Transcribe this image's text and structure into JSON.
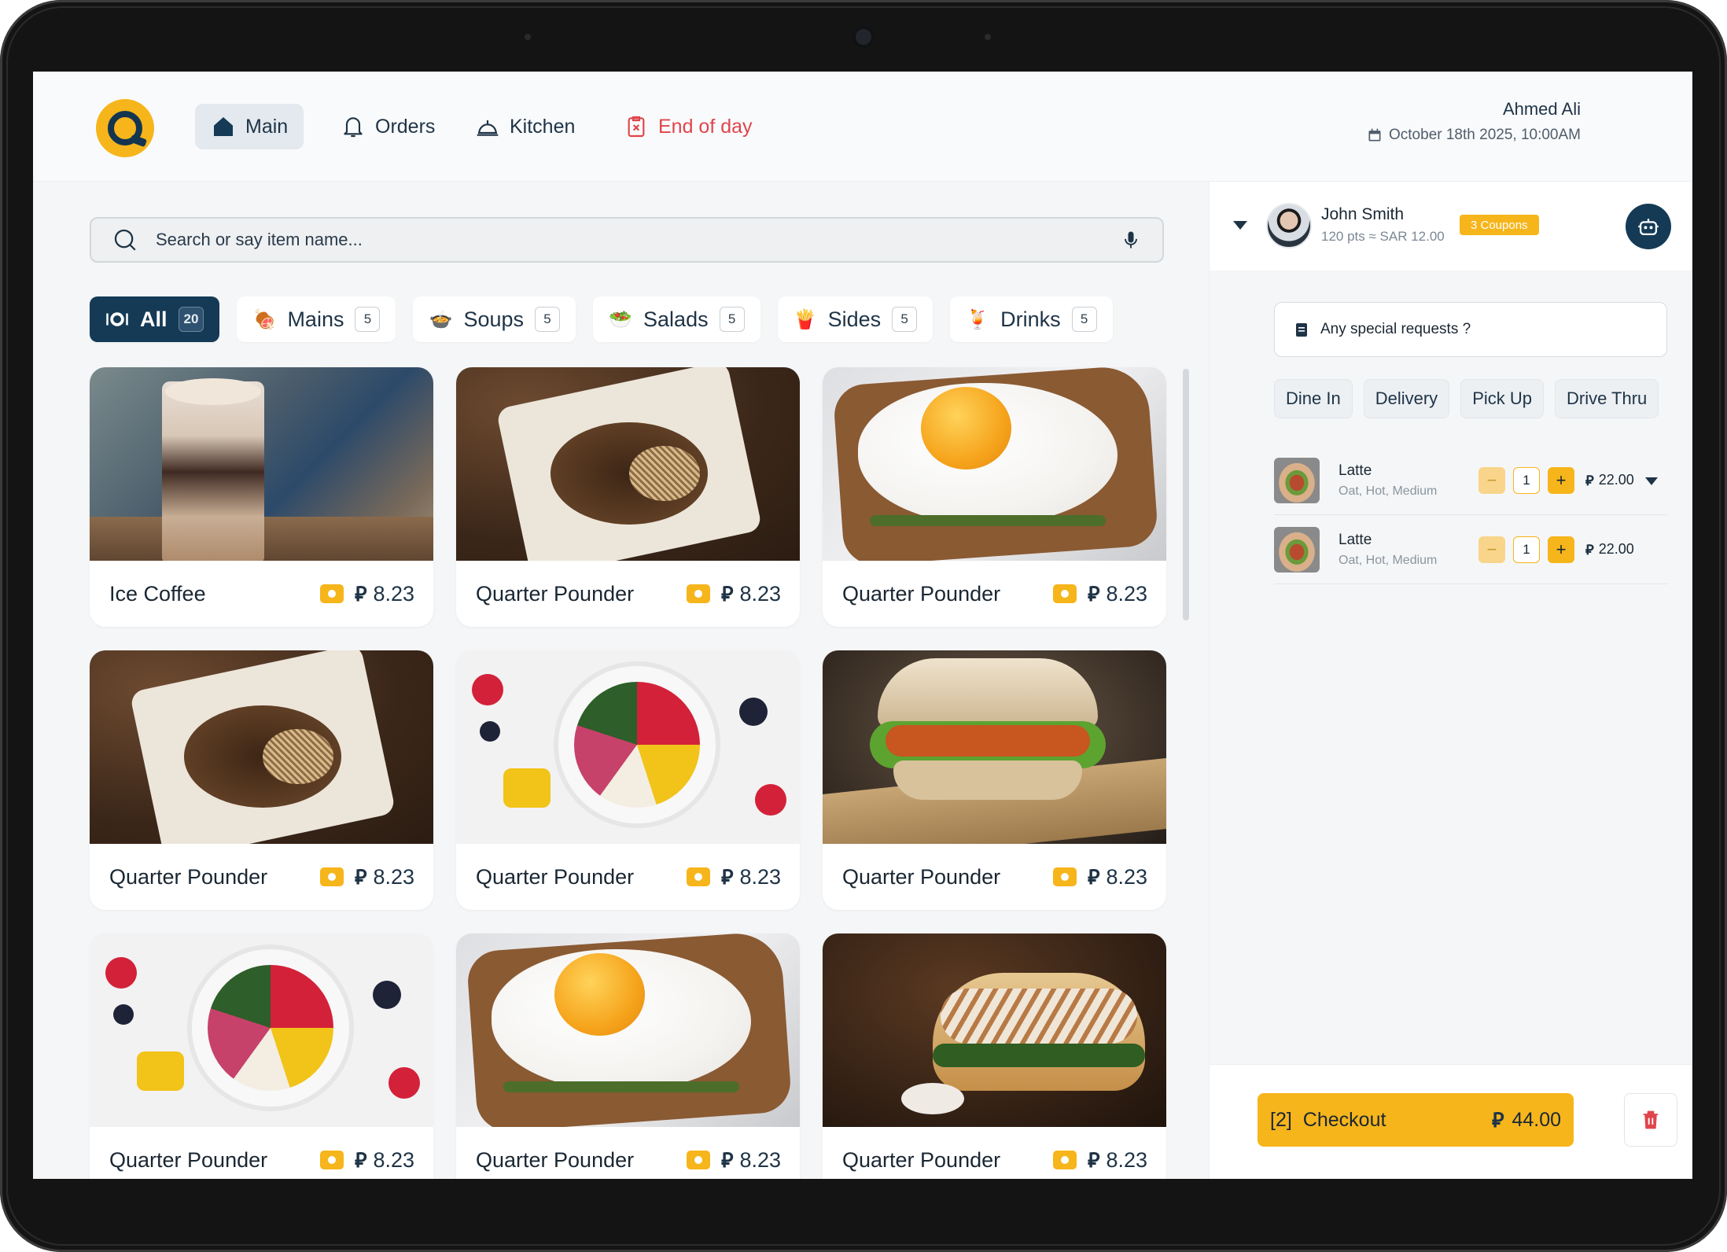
{
  "nav": {
    "items": [
      {
        "label": "Main",
        "icon": "home-icon",
        "active": true
      },
      {
        "label": "Orders",
        "icon": "bell-icon"
      },
      {
        "label": "Kitchen",
        "icon": "cloche-icon"
      },
      {
        "label": "End of day",
        "icon": "clipboard-x-icon",
        "color": "#e0444c"
      }
    ]
  },
  "user": {
    "name": "Ahmed Ali",
    "datetime": "October 18th 2025, 10:00AM"
  },
  "search": {
    "placeholder": "Search or say item name..."
  },
  "categories": [
    {
      "label": "All",
      "count": "20",
      "icon": "plate-icon",
      "active": true
    },
    {
      "label": "Mains",
      "count": "5",
      "icon": "🍖"
    },
    {
      "label": "Soups",
      "count": "5",
      "icon": "🍲"
    },
    {
      "label": "Salads",
      "count": "5",
      "icon": "🥗"
    },
    {
      "label": "Sides",
      "count": "5",
      "icon": "🍟"
    },
    {
      "label": "Drinks",
      "count": "5",
      "icon": "🍹"
    }
  ],
  "currency_symbol": "⃁",
  "products": [
    {
      "name": "Ice Coffee",
      "price": "8.23",
      "image": "coffee"
    },
    {
      "name": "Quarter Pounder",
      "price": "8.23",
      "image": "meat"
    },
    {
      "name": "Quarter Pounder",
      "price": "8.23",
      "image": "egg"
    },
    {
      "name": "Quarter Pounder",
      "price": "8.23",
      "image": "meat"
    },
    {
      "name": "Quarter Pounder",
      "price": "8.23",
      "image": "bowl"
    },
    {
      "name": "Quarter Pounder",
      "price": "8.23",
      "image": "burger"
    },
    {
      "name": "Quarter Pounder",
      "price": "8.23",
      "image": "bowl"
    },
    {
      "name": "Quarter Pounder",
      "price": "8.23",
      "image": "egg"
    },
    {
      "name": "Quarter Pounder",
      "price": "8.23",
      "image": "sandwich"
    }
  ],
  "customer": {
    "name": "John Smith",
    "points": "120 pts ≈ SAR 12.00",
    "coupons": "3 Coupons"
  },
  "special_requests": {
    "placeholder": "Any special requests ?"
  },
  "order_types": [
    "Dine In",
    "Delivery",
    "Pick Up",
    "Drive Thru"
  ],
  "cart": [
    {
      "name": "Latte",
      "options": "Oat, Hot, Medium",
      "qty": "1",
      "price": "22.00",
      "expanded_caret": true
    },
    {
      "name": "Latte",
      "options": "Oat, Hot, Medium",
      "qty": "1",
      "price": "22.00",
      "expanded_caret": false
    }
  ],
  "checkout": {
    "count": "[2]",
    "label": "Checkout",
    "total": "44.00"
  },
  "colors": {
    "brand_yellow": "#f6b51b",
    "brand_navy": "#143a56",
    "danger": "#e0444c"
  }
}
